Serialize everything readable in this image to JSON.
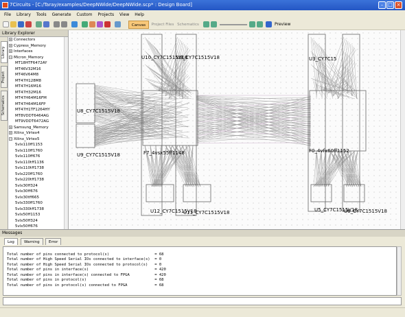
{
  "window": {
    "title": "7Circuits - [C:/Taray/examples/DeepNWide/DeepNWide.scp* : Design Board]"
  },
  "menu": [
    "File",
    "Library",
    "Tools",
    "Generate",
    "Custom",
    "Projects",
    "View",
    "Help"
  ],
  "toolbar": {
    "canvas": "Canvas",
    "project_files": "Project Files",
    "schematics": "Schematics",
    "preview": "Preview"
  },
  "library": {
    "title": "Library Explorer",
    "side_tabs": [
      "Library",
      "Project",
      "Schematics"
    ],
    "groups": [
      "Connectors",
      "Cypress_Memory",
      "Interfaces",
      "Micron_Memory"
    ],
    "micron_items": [
      "MT18HTF6472AY",
      "MT46V32M16",
      "MT46V64M8",
      "MT47H128M8",
      "MT47H16M16",
      "MT47H32M16",
      "MT47H64M16FM",
      "MT47H64M16FP",
      "MT47H1TF1264HY",
      "MT8VDDT6464AG",
      "MT9VDDT6472AG"
    ],
    "groups2": [
      "Samsung_Memory",
      "Xilinx_Virtex4",
      "Xilinx_Virtex5"
    ],
    "virtex5_items": [
      "5vlx110ff1153",
      "5vlx110ff1760",
      "5vlx110ff676",
      "5vlx110tff1136",
      "5vlx110tff1738",
      "5vlx220ff1760",
      "5vlx220tff1738",
      "5vlx30ff324",
      "5vlx30ff676",
      "5vlx30tff665",
      "5vlx330ff1760",
      "5vlx330tff1738",
      "5vlx50ff1153",
      "5vlx50ff324",
      "5vlx50ff676"
    ]
  },
  "canvas": {
    "u10": "U10_CY7C1515V18",
    "u10b": "U9_CY7C1515V18",
    "u3": "U3_CY7C15",
    "u3b": "U4_CY7C",
    "u8": "U8_CY7C1515V18",
    "u9": "U9_CY7C1515V18",
    "f7": "F7_4vsx55ff1148",
    "f0": "F0_4vfx60ff1152",
    "u12": "U12_CY7C1515V18",
    "u11": "U11_CY7C1515V18",
    "u5": "U5_CY7C1515V18",
    "u6": "U6_CY7C1515V18"
  },
  "messages": {
    "title": "Messages",
    "tabs": [
      "Log",
      "Warning",
      "Error"
    ],
    "lines": [
      "Total number of pins connected to protocol(s)                    = 68",
      "Total number of High Speed Serial IOs connected to interface(s)  = 0",
      "Total number of High Speed Serial IOs connected to protocol(s)   = 0",
      "",
      "Total number of pins in interface(s)                             = 420",
      "Total number of pins in interface(s) connected to FPGA           = 420",
      "Total number of pins in protocol(s)                              = 68",
      "Total number of pins in protocol(s) connected to FPGA            = 68"
    ]
  }
}
